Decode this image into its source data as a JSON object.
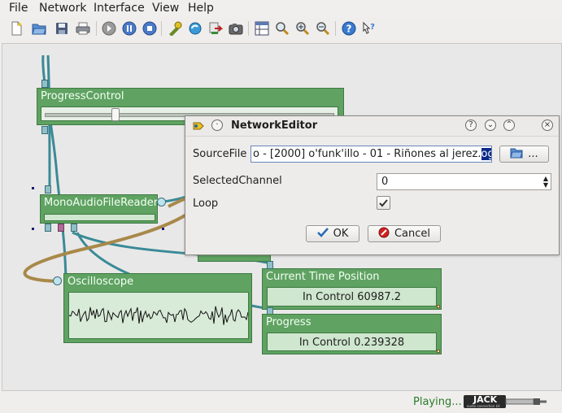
{
  "menu": [
    "File",
    "Network",
    "Interface",
    "View",
    "Help"
  ],
  "toolbar_icons": [
    "new-icon",
    "open-icon",
    "save-icon",
    "print-icon",
    "step-icon",
    "pause-icon",
    "stop-icon",
    "add-processing-icon",
    "refresh-icon",
    "export-icon",
    "camera-icon",
    "grid-icon",
    "zoom-fit-icon",
    "zoom-in-icon",
    "zoom-out-icon",
    "help-icon",
    "whats-this-icon"
  ],
  "nodes": {
    "progress_control": {
      "title": "ProgressControl"
    },
    "mono_reader": {
      "title": "MonoAudioFileReader"
    },
    "oscilloscope": {
      "title": "Oscilloscope"
    },
    "current_time": {
      "title": "Current Time Position",
      "value": "In Control 60987.2"
    },
    "progress": {
      "title": "Progress",
      "value": "In Control 0.239328"
    }
  },
  "dialog": {
    "title": "NetworkEditor",
    "source_label": "SourceFile",
    "source_value": "o - [2000] o'funk'illo - 01 - Riñones al jerez.",
    "source_selected": "ogg",
    "browse_label": "...",
    "channel_label": "SelectedChannel",
    "channel_value": "0",
    "loop_label": "Loop",
    "loop_checked": true,
    "ok_label": "OK",
    "cancel_label": "Cancel"
  },
  "status": {
    "text": "Playing...",
    "jack_label": "JACK",
    "jack_sub": "audio connection kit"
  },
  "colors": {
    "node": "#5fa262",
    "wire_audio": "#3a8a96",
    "wire_control": "#a8894a",
    "status_text": "#2a7a2a",
    "selection": "#0a2a8a"
  }
}
